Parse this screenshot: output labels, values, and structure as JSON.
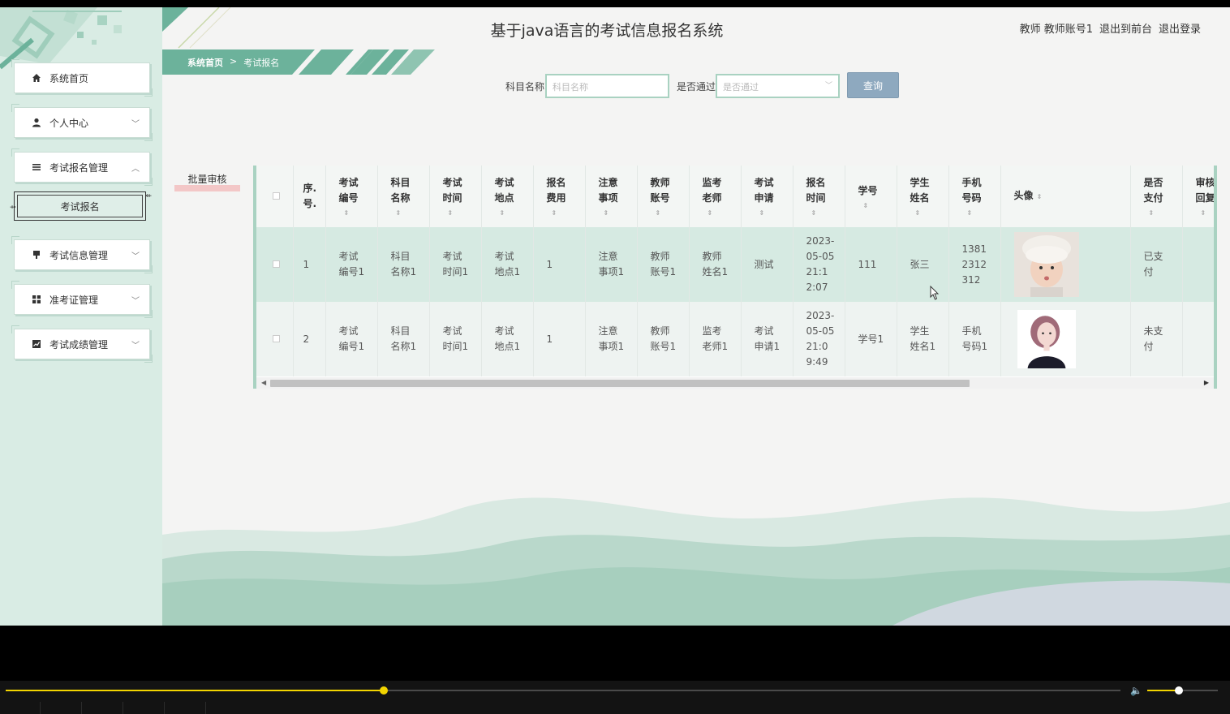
{
  "app": {
    "title": "基于java语言的考试信息报名系统",
    "header_links": [
      "教师 教师账号1",
      "退出到前台",
      "退出登录"
    ]
  },
  "sidebar": {
    "items": [
      {
        "label": "系统首页",
        "icon": "home-icon",
        "expand": ""
      },
      {
        "label": "个人中心",
        "icon": "user-icon",
        "expand": "﹀"
      },
      {
        "label": "考试报名管理",
        "icon": "list-icon",
        "expand": "︿"
      },
      {
        "label": "考试信息管理",
        "icon": "pin-icon",
        "expand": "﹀"
      },
      {
        "label": "准考证管理",
        "icon": "grid-icon",
        "expand": "﹀"
      },
      {
        "label": "考试成绩管理",
        "icon": "chart-icon",
        "expand": "﹀"
      }
    ],
    "submenu_active": "考试报名"
  },
  "breadcrumb": {
    "home": "系统首页",
    "sep": ">",
    "current": "考试报名"
  },
  "search": {
    "subject_label": "科目名称",
    "subject_placeholder": "科目名称",
    "passed_label": "是否通过",
    "passed_placeholder": "是否通过",
    "query_button": "查询"
  },
  "batch_button": "批量审核",
  "table": {
    "headers": [
      {
        "l1": "序.",
        "l2": "号."
      },
      {
        "l1": "考试",
        "l2": "编号"
      },
      {
        "l1": "科目",
        "l2": "名称"
      },
      {
        "l1": "考试",
        "l2": "时间"
      },
      {
        "l1": "考试",
        "l2": "地点"
      },
      {
        "l1": "报名",
        "l2": "费用"
      },
      {
        "l1": "注意",
        "l2": "事项"
      },
      {
        "l1": "教师",
        "l2": "账号"
      },
      {
        "l1": "监考",
        "l2": "老师"
      },
      {
        "l1": "考试",
        "l2": "申请"
      },
      {
        "l1": "报名",
        "l2": "时间"
      },
      {
        "l1": "学号",
        "l2": ""
      },
      {
        "l1": "学生",
        "l2": "姓名"
      },
      {
        "l1": "手机",
        "l2": "号码"
      },
      {
        "l1": "头像",
        "l2": ""
      },
      {
        "l1": "是否",
        "l2": "支付"
      },
      {
        "l1": "审核",
        "l2": "回复"
      }
    ],
    "rows": [
      {
        "index": "1",
        "exam_no": [
          "考试",
          "编号1"
        ],
        "subject": [
          "科目",
          "名称1"
        ],
        "time": [
          "考试",
          "时间1"
        ],
        "place": [
          "考试",
          "地点1"
        ],
        "fee": "1",
        "notes": [
          "注意",
          "事项1"
        ],
        "teacher_account": [
          "教师",
          "账号1"
        ],
        "proctor": [
          "教师",
          "姓名1"
        ],
        "application": [
          "测试"
        ],
        "reg_time": [
          "2023-",
          "05-05",
          "21:1",
          "2:07"
        ],
        "student_no": [
          "111"
        ],
        "student_name": [
          "张三"
        ],
        "phone": [
          "1381",
          "2312",
          "312"
        ],
        "avatar": "child-avatar",
        "paid": [
          "已支",
          "付"
        ],
        "reply": ""
      },
      {
        "index": "2",
        "exam_no": [
          "考试",
          "编号1"
        ],
        "subject": [
          "科目",
          "名称1"
        ],
        "time": [
          "考试",
          "时间1"
        ],
        "place": [
          "考试",
          "地点1"
        ],
        "fee": "1",
        "notes": [
          "注意",
          "事项1"
        ],
        "teacher_account": [
          "教师",
          "账号1"
        ],
        "proctor": [
          "监考",
          "老师1"
        ],
        "application": [
          "考试",
          "申请1"
        ],
        "reg_time": [
          "2023-",
          "05-05",
          "21:0",
          "9:49"
        ],
        "student_no": [
          "学号1"
        ],
        "student_name": [
          "学生",
          "姓名1"
        ],
        "phone": [
          "手机",
          "号码1"
        ],
        "avatar": "woman-avatar",
        "paid": [
          "未支",
          "付"
        ],
        "reply": ""
      }
    ]
  },
  "colors": {
    "accent": "#6cb29b",
    "sidebar_bg": "#d9ece4",
    "row_highlight": "#d6eae2",
    "query_button": "#8ea9bf",
    "player_accent": "#f2d400"
  },
  "player": {
    "progress_fraction": 0.339,
    "volume_fraction": 0.45
  }
}
